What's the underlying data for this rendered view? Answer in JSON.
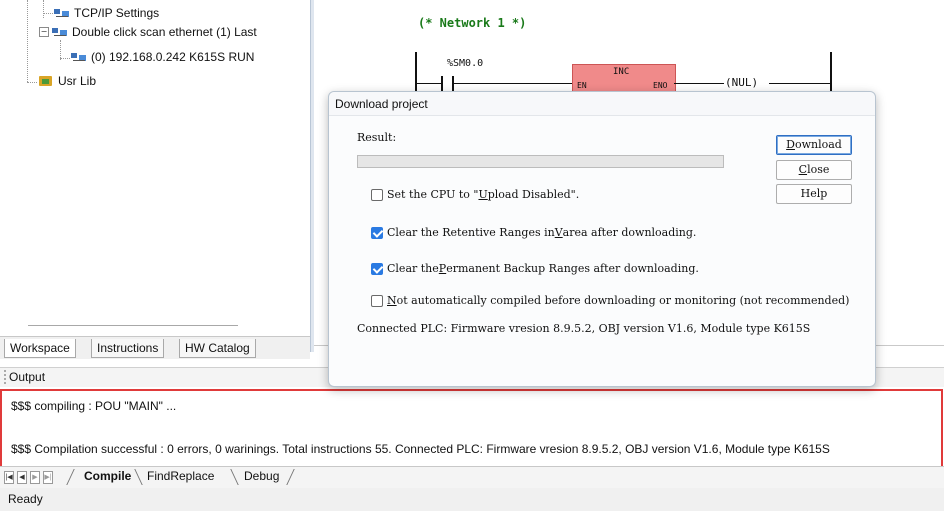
{
  "tree": {
    "items": [
      {
        "label": "TCP/IP Settings"
      },
      {
        "label": "Double click scan ethernet (1) Last"
      },
      {
        "label": "(0) 192.168.0.242 K615S RUN"
      },
      {
        "label": "Usr Lib"
      }
    ],
    "expander_symbol": "−"
  },
  "workspace_tabs": [
    "Workspace",
    "Instructions",
    "HW Catalog"
  ],
  "ladder": {
    "network_title": "(* Network 1 *)",
    "contact_label": "%SM0.0",
    "block_name": "INC",
    "block_en": "EN",
    "block_eno": "ENO",
    "coil_label": "(NUL)"
  },
  "dialog": {
    "title": "Download project",
    "result_label": "Result:",
    "progress": 0,
    "buttons": {
      "download": {
        "pre": "",
        "key": "D",
        "post": "ownload"
      },
      "close": {
        "pre": "",
        "key": "C",
        "post": "lose"
      },
      "help": {
        "label": "Help"
      }
    },
    "options": [
      {
        "checked": false,
        "pre": "Set the CPU to \"",
        "key": "U",
        "post": "pload Disabled\"."
      },
      {
        "checked": true,
        "pre": "Clear the Retentive Ranges in ",
        "key": "V",
        "post": " area after downloading."
      },
      {
        "checked": true,
        "pre": "Clear the ",
        "key": "P",
        "post": "ermanent Backup Ranges after downloading."
      },
      {
        "checked": false,
        "pre": "",
        "key": "N",
        "post": "ot automatically compiled before downloading or monitoring (not recommended)"
      }
    ],
    "connected_info": "Connected PLC: Firmware vresion 8.9.5.2, OBJ version V1.6, Module type K615S"
  },
  "output": {
    "header": "Output",
    "lines": [
      "$$$ compiling   : POU \"MAIN\" ...",
      "$$$ Compilation successful   : 0 errors, 0 warinings.  Total instructions 55. Connected PLC: Firmware vresion 8.9.5.2, OBJ version V1.6, Module type K615S"
    ]
  },
  "bottom_tabs": [
    "Compile",
    "FindReplace",
    "Debug"
  ],
  "status": "Ready",
  "colors": {
    "highlight_border": "#e03a3a",
    "checkbox_on": "#2a7ae2",
    "network_title": "#1a7a1a",
    "block_fill": "#f08a8a"
  }
}
